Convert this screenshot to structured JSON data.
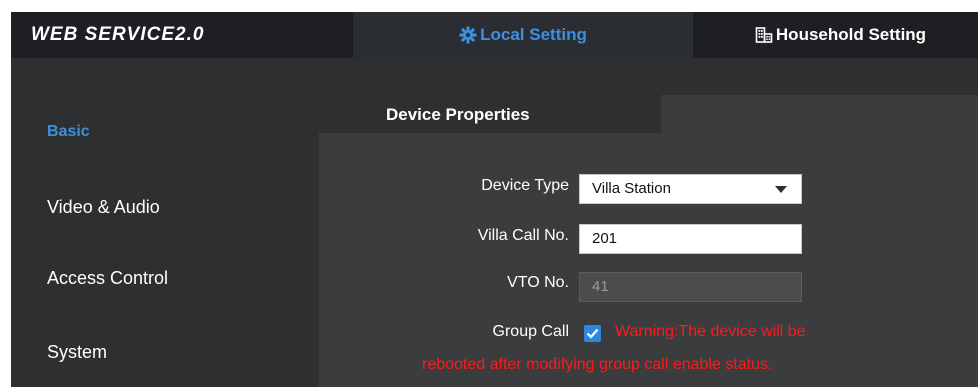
{
  "header": {
    "logo": "WEB SERVICE2.0",
    "tabs": [
      {
        "label": "Local Setting",
        "icon": "gear-icon",
        "active": true
      },
      {
        "label": "Household Setting",
        "icon": "building-icon",
        "active": false
      }
    ]
  },
  "sidebar": {
    "items": [
      {
        "label": "Basic",
        "active": true
      },
      {
        "label": "Video & Audio",
        "active": false
      },
      {
        "label": "Access Control",
        "active": false
      },
      {
        "label": "System",
        "active": false
      }
    ]
  },
  "panel": {
    "tab_label": "Device Properties",
    "device_type": {
      "label": "Device Type",
      "value": "Villa Station"
    },
    "villa_call_no": {
      "label": "Villa Call No.",
      "value": "201"
    },
    "vto_no": {
      "label": "VTO No.",
      "value": "41"
    },
    "group_call": {
      "label": "Group Call",
      "checked": true,
      "warning_line1": "Warning:The device will be",
      "warning_line2": "rebooted after modifying group call enable status."
    }
  },
  "colors": {
    "accent": "#3d8fe0",
    "warning": "#ff1a1a",
    "topbar": "#1d1f22",
    "background": "#2d2f31",
    "panel": "#3a3c3e"
  }
}
